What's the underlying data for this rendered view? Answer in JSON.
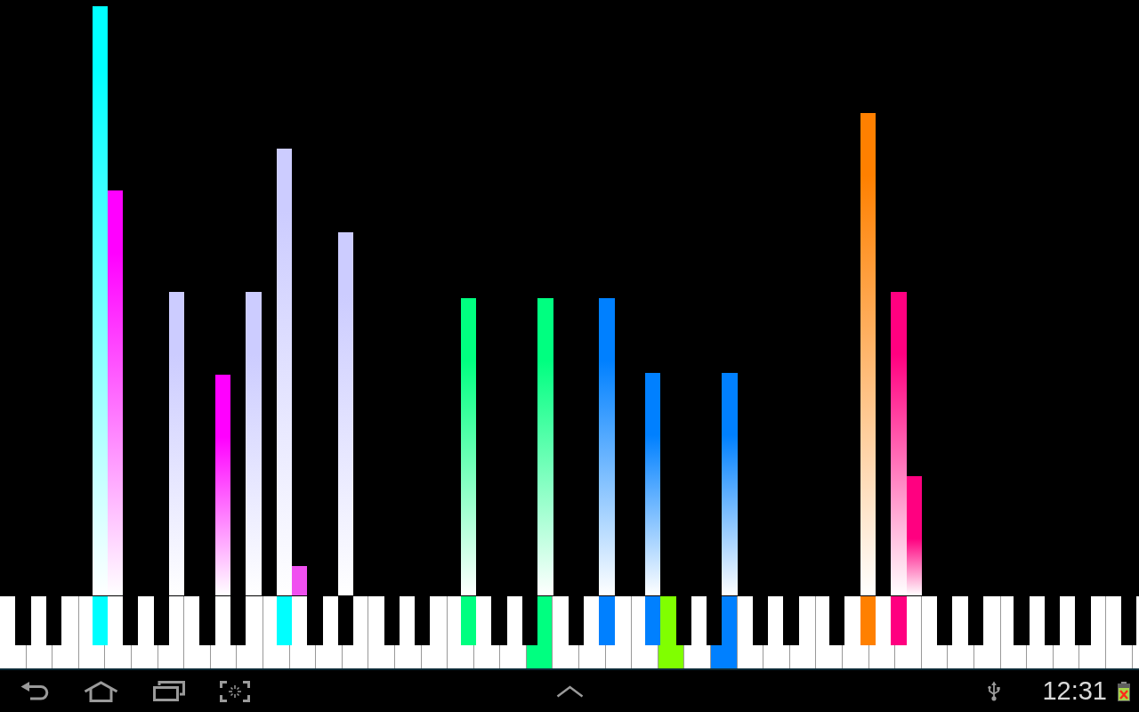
{
  "keyboard": {
    "keys": [
      {
        "kind": "white",
        "pressed": false
      },
      {
        "kind": "black",
        "pressed": false
      },
      {
        "kind": "white",
        "pressed": false
      },
      {
        "kind": "black",
        "pressed": false
      },
      {
        "kind": "white",
        "pressed": false
      },
      {
        "kind": "white",
        "pressed": false
      },
      {
        "kind": "black",
        "pressed": true,
        "color": "#00ffff",
        "bar": {
          "color": "#00ffff",
          "level": 0.99
        }
      },
      {
        "kind": "white",
        "pressed": false,
        "bar": {
          "color": "#ff00ff",
          "level": 0.68
        }
      },
      {
        "kind": "black",
        "pressed": false
      },
      {
        "kind": "white",
        "pressed": false
      },
      {
        "kind": "black",
        "pressed": false
      },
      {
        "kind": "white",
        "pressed": false,
        "bar": {
          "color": "#ccccff",
          "level": 0.51
        }
      },
      {
        "kind": "white",
        "pressed": false
      },
      {
        "kind": "black",
        "pressed": false
      },
      {
        "kind": "white",
        "pressed": false,
        "bar": {
          "color": "#ff00ff",
          "level": 0.37
        }
      },
      {
        "kind": "black",
        "pressed": false
      },
      {
        "kind": "white",
        "pressed": false,
        "bar": {
          "color": "#ccccff",
          "level": 0.51
        }
      },
      {
        "kind": "white",
        "pressed": false
      },
      {
        "kind": "black",
        "pressed": true,
        "color": "#00ffff",
        "bar": {
          "color": "#ccccff",
          "level": 0.75
        }
      },
      {
        "kind": "white",
        "pressed": false,
        "bar": {
          "color": "#f050f0",
          "level": 0.05
        }
      },
      {
        "kind": "black",
        "pressed": false
      },
      {
        "kind": "white",
        "pressed": false
      },
      {
        "kind": "black",
        "pressed": false,
        "bar": {
          "color": "#ccccff",
          "level": 0.61
        }
      },
      {
        "kind": "white",
        "pressed": false
      },
      {
        "kind": "white",
        "pressed": false
      },
      {
        "kind": "black",
        "pressed": false
      },
      {
        "kind": "white",
        "pressed": false
      },
      {
        "kind": "black",
        "pressed": false
      },
      {
        "kind": "white",
        "pressed": false
      },
      {
        "kind": "white",
        "pressed": false
      },
      {
        "kind": "black",
        "pressed": true,
        "color": "#00ff80",
        "bar": {
          "color": "#00ff80",
          "level": 0.5
        }
      },
      {
        "kind": "white",
        "pressed": false
      },
      {
        "kind": "black",
        "pressed": false
      },
      {
        "kind": "white",
        "pressed": false
      },
      {
        "kind": "black",
        "pressed": false
      },
      {
        "kind": "white",
        "pressed": true,
        "color": "#00ff80",
        "bar": {
          "color": "#00ff80",
          "level": 0.5
        }
      },
      {
        "kind": "white",
        "pressed": false
      },
      {
        "kind": "black",
        "pressed": false
      },
      {
        "kind": "white",
        "pressed": false
      },
      {
        "kind": "black",
        "pressed": true,
        "color": "#0080ff",
        "bar": {
          "color": "#0080ff",
          "level": 0.5
        }
      },
      {
        "kind": "white",
        "pressed": false
      },
      {
        "kind": "white",
        "pressed": false
      },
      {
        "kind": "black",
        "pressed": true,
        "color": "#0080ff",
        "bar": {
          "color": "#0080ff",
          "level": 0.374
        }
      },
      {
        "kind": "white",
        "pressed": true,
        "color": "#80ff00"
      },
      {
        "kind": "black",
        "pressed": false
      },
      {
        "kind": "white",
        "pressed": false
      },
      {
        "kind": "black",
        "pressed": false
      },
      {
        "kind": "white",
        "pressed": true,
        "color": "#0080ff",
        "bar": {
          "color": "#0080ff",
          "level": 0.374
        }
      },
      {
        "kind": "white",
        "pressed": false
      },
      {
        "kind": "black",
        "pressed": false
      },
      {
        "kind": "white",
        "pressed": false
      },
      {
        "kind": "black",
        "pressed": false
      },
      {
        "kind": "white",
        "pressed": false
      },
      {
        "kind": "white",
        "pressed": false
      },
      {
        "kind": "black",
        "pressed": false
      },
      {
        "kind": "white",
        "pressed": false
      },
      {
        "kind": "black",
        "pressed": true,
        "color": "#ff8000",
        "bar": {
          "color": "#ff8000",
          "level": 0.81
        }
      },
      {
        "kind": "white",
        "pressed": false
      },
      {
        "kind": "black",
        "pressed": true,
        "color": "#ff0080",
        "bar": {
          "color": "#ff0080",
          "level": 0.51
        }
      },
      {
        "kind": "white",
        "pressed": false,
        "bar": {
          "color": "#ff0080",
          "level": 0.2
        }
      },
      {
        "kind": "white",
        "pressed": false
      },
      {
        "kind": "black",
        "pressed": false
      },
      {
        "kind": "white",
        "pressed": false
      },
      {
        "kind": "black",
        "pressed": false
      },
      {
        "kind": "white",
        "pressed": false
      },
      {
        "kind": "white",
        "pressed": false
      },
      {
        "kind": "black",
        "pressed": false
      },
      {
        "kind": "white",
        "pressed": false
      },
      {
        "kind": "black",
        "pressed": false
      },
      {
        "kind": "white",
        "pressed": false
      },
      {
        "kind": "black",
        "pressed": false
      },
      {
        "kind": "white",
        "pressed": false
      },
      {
        "kind": "white",
        "pressed": false
      },
      {
        "kind": "black",
        "pressed": false
      },
      {
        "kind": "white",
        "pressed": false
      }
    ]
  },
  "navigation_bar": {
    "time": "12:31"
  }
}
